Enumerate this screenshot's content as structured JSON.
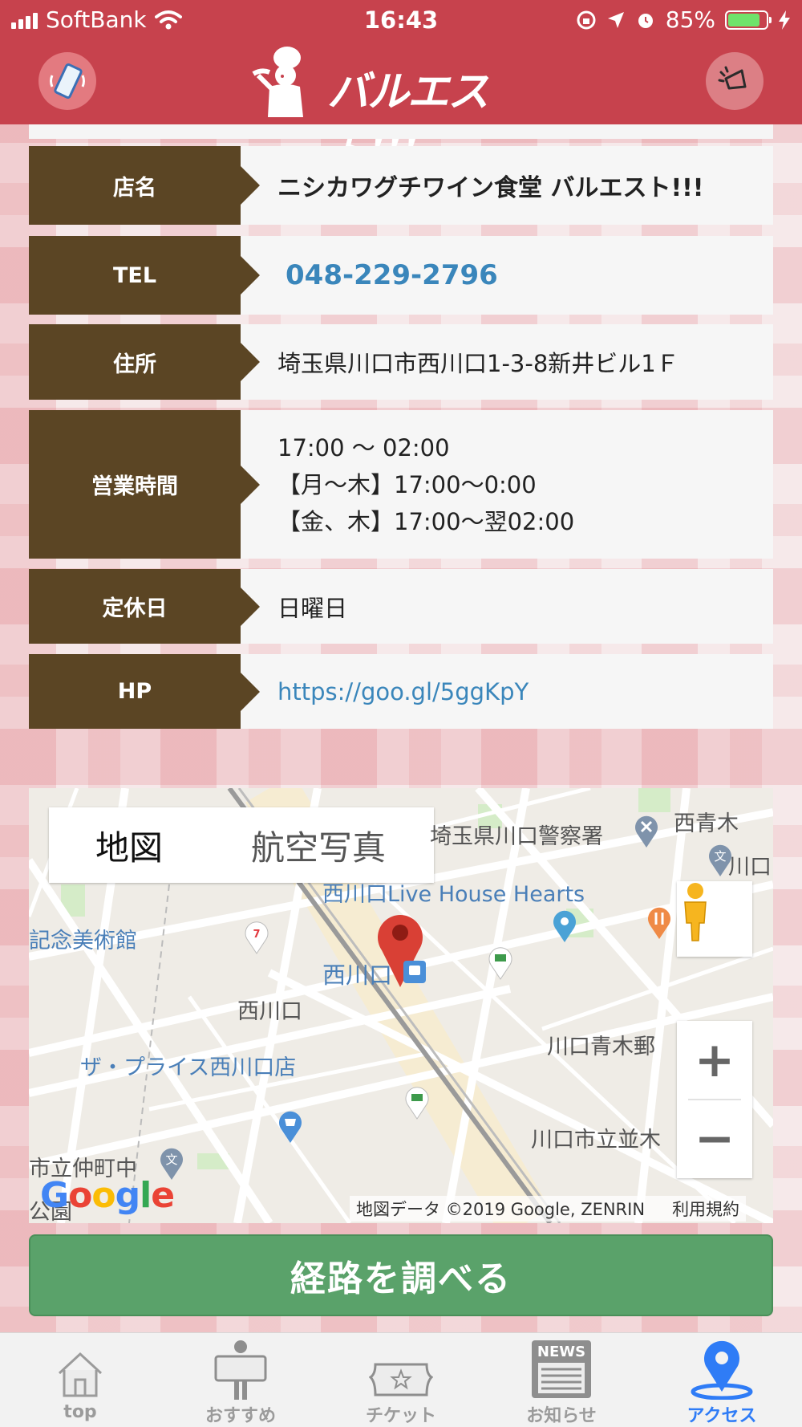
{
  "status_bar": {
    "carrier": "SoftBank",
    "time": "16:43",
    "battery_percent": "85%",
    "battery_level": 0.85,
    "colors": {
      "bar": "#c7424d",
      "battery_fill": "#6fe36b"
    }
  },
  "header": {
    "logo_text": "バルエスト!!!",
    "left_icon": "phone-icon",
    "right_icon": "megaphone-icon",
    "color": "#c7424d"
  },
  "info": {
    "name_label": "店名",
    "name_value": "ニシカワグチワイン食堂 バルエスト!!!",
    "tel_label": "TEL",
    "tel_value": "048-229-2796",
    "address_label": "住所",
    "address_value": "埼玉県川口市西川口1-3-8新井ビル1Ｆ",
    "hours_label": "営業時間",
    "hours_lines": [
      "17:00 〜 02:00",
      "【月〜木】17:00〜0:00",
      "【金、木】17:00〜翌02:00"
    ],
    "holiday_label": "定休日",
    "holiday_value": "日曜日",
    "hp_label": "HP",
    "hp_value": "https://goo.gl/5ggKpY",
    "colors": {
      "label_bg": "#5b4524",
      "link": "#3a86bb"
    }
  },
  "map": {
    "tab_map": "地図",
    "tab_satellite": "航空写真",
    "labels": {
      "police": "埼玉県川口警察署",
      "nishiaoki": "西青木",
      "kawaguchi_right": "川口",
      "live_house": "西川口Live House Hearts",
      "museum": "記念美術館",
      "station": "西川口",
      "nishikawaguchi": "西川口",
      "aoki_post": "川口青木郵",
      "the_price": "ザ・プライス西川口店",
      "namiki": "川口市立並木",
      "nakacho": "市立仲町中",
      "park": "公園"
    },
    "google": "Google",
    "attribution": "地図データ ©2019 Google, ZENRIN",
    "terms": "利用規約",
    "zoom_in": "+",
    "zoom_out": "−"
  },
  "route_button": {
    "label": "経路を調べる",
    "color": "#5aa26a"
  },
  "tabbar": {
    "items": [
      {
        "label": "top",
        "icon": "house-icon"
      },
      {
        "label": "おすすめ",
        "icon": "signboard-icon"
      },
      {
        "label": "チケット",
        "icon": "ticket-icon"
      },
      {
        "label": "お知らせ",
        "icon": "news-icon",
        "badge": "NEWS"
      },
      {
        "label": "アクセス",
        "icon": "map-pin-icon",
        "active": true
      }
    ],
    "active_color": "#2f7cf6"
  }
}
